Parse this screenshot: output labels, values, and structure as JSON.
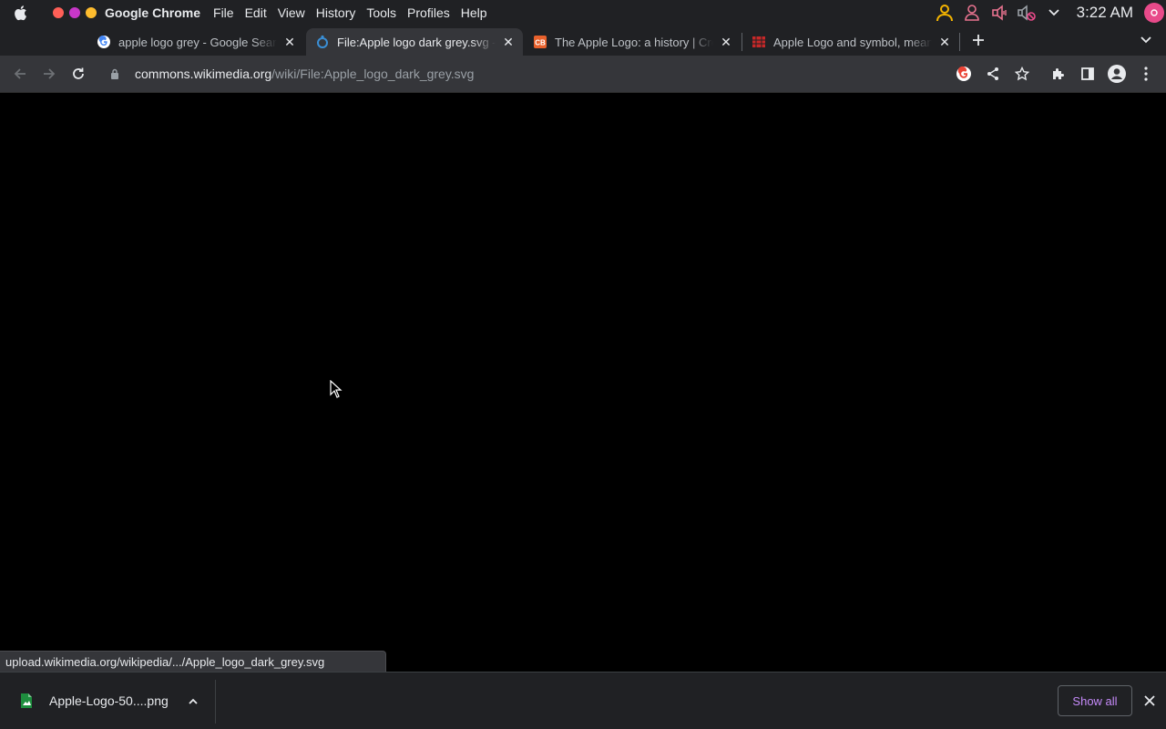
{
  "menubar": {
    "app_name": "Google Chrome",
    "items": [
      "File",
      "Edit",
      "View",
      "History",
      "Tools",
      "Profiles",
      "Help"
    ],
    "clock": "3:22 AM",
    "traffic_colors": [
      "#ff5f57",
      "#c837c8",
      "#febc2e"
    ]
  },
  "tabs": [
    {
      "title": "apple logo grey - Google Search",
      "favicon": "google-icon",
      "active": false
    },
    {
      "title": "File:Apple logo dark grey.svg - Wikimedia Commons",
      "favicon": "wikimedia-icon",
      "active": true
    },
    {
      "title": "The Apple Logo: a history | Creative Bloq",
      "favicon": "creative-bloq-icon",
      "active": false
    },
    {
      "title": "Apple Logo and symbol, meaning, history",
      "favicon": "logo-site-icon",
      "active": false
    }
  ],
  "toolbar": {
    "url_host": "commons.wikimedia.org",
    "url_path": "/wiki/File:Apple_logo_dark_grey.svg"
  },
  "status": {
    "hover_url": "upload.wikimedia.org/wikipedia/.../Apple_logo_dark_grey.svg"
  },
  "downloads": {
    "item_name": "Apple-Logo-50....png",
    "show_all_label": "Show all"
  },
  "colors": {
    "accent_purple": "#c58af9",
    "chrome_dark": "#202124",
    "toolbar": "#35363a",
    "tray_yellow": "#f4b400",
    "tray_pink": "#e84a8a"
  }
}
